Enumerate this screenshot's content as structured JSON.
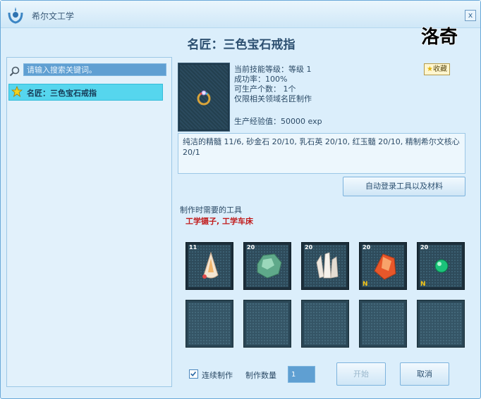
{
  "window": {
    "title": "希尔文工学",
    "close_glyph": "x"
  },
  "header": {
    "title": "名匠：三色宝石戒指",
    "favorite_label": "收藏",
    "watermark_text": "洛奇"
  },
  "search": {
    "placeholder": "请输入搜索关键词。"
  },
  "recipe_list": [
    {
      "label": "名匠：三色宝石戒指",
      "icon": "star-icon"
    }
  ],
  "item_info": {
    "skill_level": "当前技能等级：等级 1",
    "success_rate": "成功率：100%",
    "producible_count": "可生产个数： 1个",
    "restriction": "仅限相关领域名匠制作",
    "exp": "生产经验值：50000 exp"
  },
  "materials_text": "纯洁的精髓 11/6, 砂金石 20/10, 乳石英 20/10, 红玉髓 20/10, 精制希尔文核心 20/1",
  "buttons": {
    "auto_register": "自动登录工具以及材料",
    "start": "开始",
    "cancel": "取消"
  },
  "tools": {
    "heading": "制作时需要的工具",
    "list": "工学镊子, 工学车床"
  },
  "slots_top": [
    {
      "qty": "11",
      "n": "",
      "icon": "pure-essence-icon"
    },
    {
      "qty": "20",
      "n": "",
      "icon": "aventurine-icon"
    },
    {
      "qty": "20",
      "n": "",
      "icon": "milky-quartz-icon"
    },
    {
      "qty": "20",
      "n": "N",
      "icon": "carnelian-icon"
    },
    {
      "qty": "20",
      "n": "N",
      "icon": "silvan-core-icon"
    }
  ],
  "footer": {
    "continuous_label": "连续制作",
    "continuous_checked": true,
    "quantity_label": "制作数量",
    "quantity_value": "1"
  },
  "colors": {
    "window_bg": "#dbeefb",
    "selected_item": "#56d6ee",
    "tool_text": "#c11a1a",
    "search_bg": "#5f9fd2"
  }
}
